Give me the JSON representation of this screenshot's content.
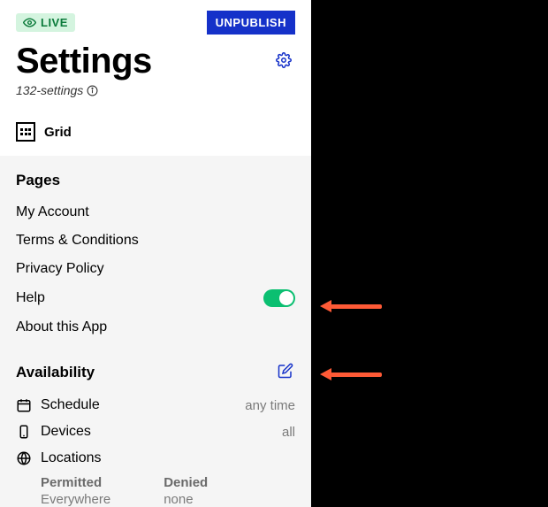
{
  "header": {
    "live_badge": "LIVE",
    "unpublish_label": "UNPUBLISH",
    "title": "Settings",
    "slug": "132-settings"
  },
  "layout_row": {
    "label": "Grid"
  },
  "pages": {
    "title": "Pages",
    "items": [
      {
        "label": "My Account"
      },
      {
        "label": "Terms & Conditions"
      },
      {
        "label": "Privacy Policy"
      },
      {
        "label": "Help",
        "toggle": true
      },
      {
        "label": "About this App"
      }
    ]
  },
  "availability": {
    "title": "Availability",
    "schedule_label": "Schedule",
    "schedule_value": "any time",
    "devices_label": "Devices",
    "devices_value": "all",
    "locations_label": "Locations",
    "permitted_label": "Permitted",
    "permitted_value": "Everywhere",
    "denied_label": "Denied",
    "denied_value": "none"
  }
}
